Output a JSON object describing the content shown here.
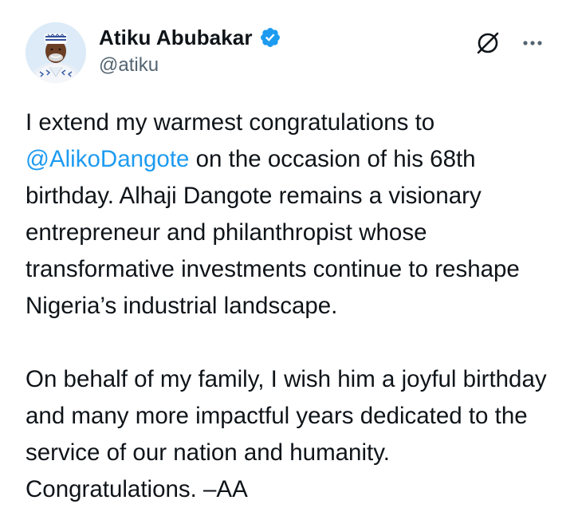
{
  "author": {
    "display_name": "Atiku Abubakar",
    "handle": "@atiku",
    "verified": true,
    "verified_color": "#1d9bf0"
  },
  "icons": {
    "verified": "verified-badge-icon",
    "grok": "grok-icon",
    "more": "more-options-icon"
  },
  "tweet": {
    "para1_before": "I extend my warmest congratulations to ",
    "mention": "@AlikoDangote",
    "para1_after": " on the occasion of his 68th birthday. Alhaji Dangote remains a visionary entrepreneur and philanthropist whose transformative investments continue to reshape Nigeria’s industrial landscape.",
    "para2": "On behalf of my family, I wish him a joyful birthday and many more impactful years dedicated to the service of our nation and humanity. Congratulations. –AA"
  },
  "colors": {
    "text": "#0f1419",
    "secondary": "#536471",
    "link": "#1d9bf0"
  }
}
